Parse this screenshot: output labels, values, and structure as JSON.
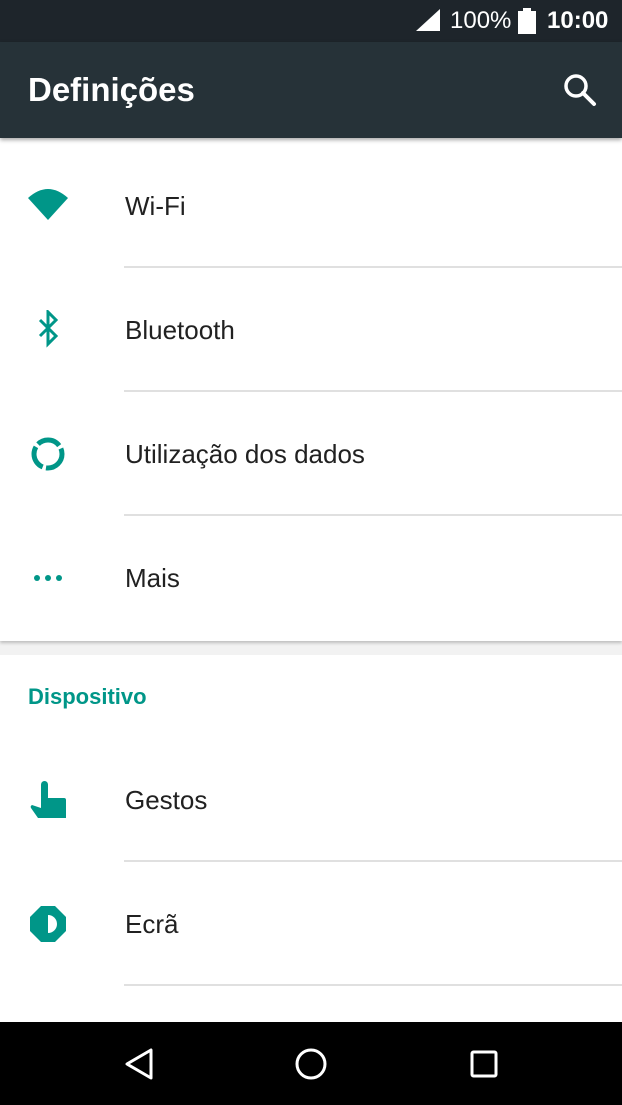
{
  "status_bar": {
    "battery_percent": "100%",
    "time": "10:00",
    "icons": [
      "signal-icon",
      "battery-icon"
    ]
  },
  "app_bar": {
    "title": "Definições",
    "icons": [
      "search-icon"
    ]
  },
  "wireless_section": {
    "items": [
      {
        "label": "Wi-Fi",
        "icon": "wifi-icon"
      },
      {
        "label": "Bluetooth",
        "icon": "bluetooth-icon"
      },
      {
        "label": "Utilização dos dados",
        "icon": "data-usage-icon"
      },
      {
        "label": "Mais",
        "icon": "more-icon"
      }
    ]
  },
  "device_section": {
    "header": "Dispositivo",
    "items": [
      {
        "label": "Gestos",
        "icon": "gesture-hand-icon"
      },
      {
        "label": "Ecrã",
        "icon": "display-brightness-icon"
      }
    ]
  },
  "nav_bar": {
    "icons": [
      "back-icon",
      "home-icon",
      "recents-icon"
    ]
  },
  "colors": {
    "accent": "#009688",
    "app_bar": "#263238",
    "status_bar": "#1e252b"
  }
}
